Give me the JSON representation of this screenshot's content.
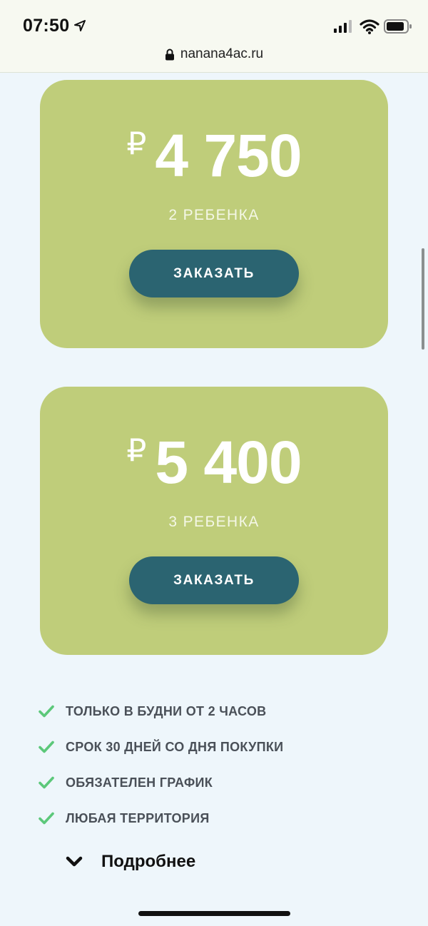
{
  "status": {
    "time": "07:50"
  },
  "browser": {
    "url": "nanana4ac.ru"
  },
  "cards": [
    {
      "currency": "₽",
      "price": "4 750",
      "subtitle": "2 РЕБЕНКА",
      "button": "ЗАКАЗАТЬ"
    },
    {
      "currency": "₽",
      "price": "5 400",
      "subtitle": "3 РЕБЕНКА",
      "button": "ЗАКАЗАТЬ"
    }
  ],
  "features": [
    "ТОЛЬКО В БУДНИ ОТ 2 ЧАСОВ",
    "СРОК 30 ДНЕЙ СО ДНЯ ПОКУПКИ",
    "ОБЯЗАТЕЛЕН ГРАФИК",
    "ЛЮБАЯ ТЕРРИТОРИЯ"
  ],
  "more": {
    "label": "Подробнее"
  },
  "colors": {
    "card": "#bfcd7a",
    "button": "#2b6471",
    "check": "#5cc87a",
    "background": "#eef6fb"
  },
  "icons": [
    "location-arrow-icon",
    "signal-icon",
    "wifi-icon",
    "battery-icon",
    "lock-icon",
    "check-icon",
    "chevron-down-icon"
  ]
}
